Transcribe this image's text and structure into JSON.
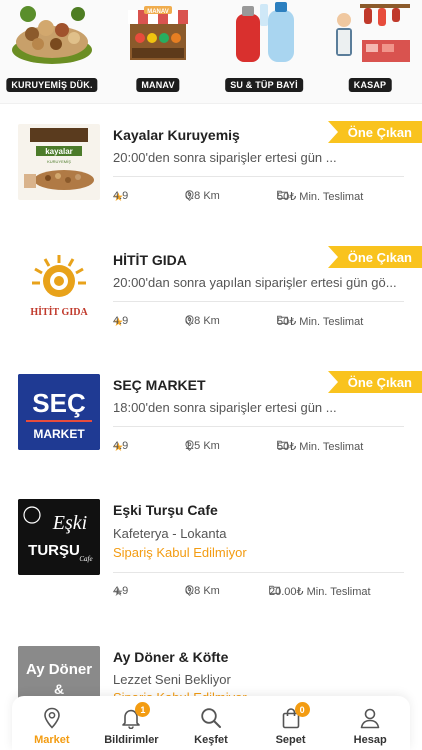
{
  "categories": [
    {
      "label": "KURUYEMİŞ DÜK.",
      "icon": "nuts-basket-icon"
    },
    {
      "label": "MANAV",
      "icon": "greengrocer-stall-icon"
    },
    {
      "label": "SU & TÜP BAYİ",
      "icon": "gas-water-icon"
    },
    {
      "label": "KASAP",
      "icon": "butcher-icon"
    }
  ],
  "stores": [
    {
      "name": "Kayalar Kuruyemiş",
      "description": "20:00'den sonra siparişler ertesi gün ...",
      "badge": "Öne Çıkan",
      "rating": "4.9",
      "distance": "0.8 Km",
      "min_delivery": "50₺ Min. Teslimat",
      "logo_text": "kayalar",
      "logo_sub": "KURUYEMİŞ"
    },
    {
      "name": "HİTİT GIDA",
      "description": "20:00'dan sonra yapılan siparişler ertesi gün gö...",
      "badge": "Öne Çıkan",
      "rating": "4.9",
      "distance": "0.8 Km",
      "min_delivery": "50₺ Min. Teslimat",
      "logo_text": "HİTİT GIDA"
    },
    {
      "name": "SEÇ MARKET",
      "description": "18:00'den sonra siparişler ertesi gün ...",
      "badge": "Öne Çıkan",
      "rating": "4.9",
      "distance": "1.5 Km",
      "min_delivery": "50₺ Min. Teslimat",
      "logo_text": "SEÇ",
      "logo_sub": "MARKET"
    },
    {
      "name": "Eşki Turşu Cafe",
      "description": "Kafeterya - Lokanta",
      "status": "Sipariş Kabul Edilmiyor",
      "rating": "4.9",
      "distance": "0.8 Km",
      "min_delivery": "20.00₺ Min. Teslimat",
      "logo_text": "Eşki",
      "logo_sub": "TURŞU"
    },
    {
      "name": "Ay Döner & Köfte",
      "description": "Lezzet Seni Bekliyor",
      "status": "Sipariş Kabul Edilmiyor",
      "logo_text": "Ay Döner",
      "logo_sub": "&"
    }
  ],
  "tabbar": {
    "tabs": [
      {
        "label": "Market",
        "icon": "location-pin-icon",
        "active": true
      },
      {
        "label": "Bildirimler",
        "icon": "bell-icon",
        "badge": "1"
      },
      {
        "label": "Keşfet",
        "icon": "search-icon"
      },
      {
        "label": "Sepet",
        "icon": "shopping-bag-icon",
        "badge": "0"
      },
      {
        "label": "Hesap",
        "icon": "user-icon"
      }
    ]
  },
  "colors": {
    "accent": "#f39c12",
    "badge": "#f9c31e",
    "star": "#f5a623"
  }
}
